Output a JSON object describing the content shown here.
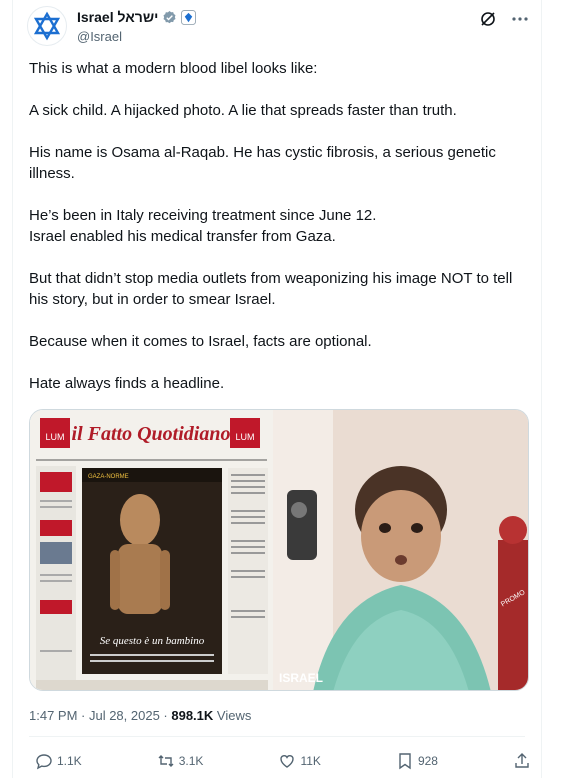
{
  "author": {
    "display_name": "Israel ישראל",
    "handle": "@Israel",
    "avatar_icon": "star-of-david-icon",
    "verified_icon": "verified-badge-icon",
    "gov_icon": "government-affiliation-icon"
  },
  "header_actions": {
    "grok_icon": "grok-icon",
    "more_icon": "more-icon"
  },
  "tweet": {
    "paragraphs": [
      "This is what a modern blood libel looks like:",
      "A sick child. A hijacked photo. A lie that spreads faster than truth.",
      "His name is Osama al-Raqab. He has cystic fibrosis, a serious genetic illness.",
      "He’s been in Italy receiving treatment since June 12.",
      "Israel enabled his medical transfer from Gaza.",
      "But that didn’t stop media outlets from weaponizing his image NOT to tell his story, but in order to smear Israel.",
      "Because when it comes to Israel, facts are optional.",
      "Hate always finds a headline."
    ]
  },
  "media": {
    "left_newspaper": {
      "masthead": "il Fatto Quotidiano",
      "side_label": "LUM",
      "headline": "Se questo è un bambino",
      "banner": "GAZA-NORME"
    },
    "right_watermark": "ISRAEL",
    "right_sticker": "PROMO"
  },
  "meta": {
    "time": "1:47 PM · Jul 28, 2025 · ",
    "views_count": "898.1K",
    "views_label": " Views"
  },
  "actions": {
    "reply": "1.1K",
    "retweet": "3.1K",
    "like": "11K",
    "bookmark": "928"
  },
  "colors": {
    "accent": "#1d9bf0",
    "muted": "#536471",
    "text": "#0f1419",
    "gold": "#e2b719"
  }
}
